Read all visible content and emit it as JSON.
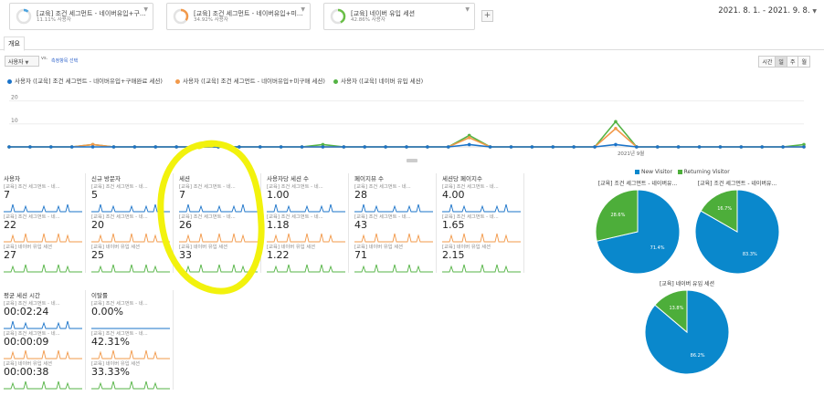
{
  "segments": [
    {
      "name": "[교육] 조건 세그먼트 - 네이버유입+구...",
      "pct": "11.11% 사용자",
      "color": "#4aa3df",
      "fraction": 0.111
    },
    {
      "name": "[교육] 조건 세그먼트 - 네이버유입+미...",
      "pct": "34.92% 사용자",
      "color": "#f2994a",
      "fraction": 0.349
    },
    {
      "name": "[교육] 네이버 유입 세션",
      "pct": "42.86% 사용자",
      "color": "#6abf47",
      "fraction": 0.429
    }
  ],
  "add_segment_label": "+",
  "date_range": "2021. 8. 1. - 2021. 9. 8.",
  "tab_overview": "개요",
  "metric_select": "사용자",
  "vs_label": "vs.",
  "select_metric_label": "측정항목 선택",
  "granularity": [
    "시간",
    "일",
    "주",
    "월"
  ],
  "granularity_active": "일",
  "legend": [
    "사용자 ([교육] 조건 세그먼트 - 네이버유입+구매완료 세션)",
    "사용자 ([교육] 조건 세그먼트 - 네이버유입+미구매 세션)",
    "사용자 ([교육] 네이버 유입 세션)"
  ],
  "colors": {
    "blue": "#1a73c9",
    "orange": "#f2994a",
    "green": "#54b344",
    "pie_blue": "#0a88cc",
    "pie_green": "#4dae3a",
    "highlight": "#f2f20d"
  },
  "chart_data": {
    "type": "line",
    "ylabel_ticks": [
      "20",
      "10"
    ],
    "ylim": [
      0,
      25
    ],
    "x_annotation": "2021년 9월",
    "series": [
      {
        "name": "사용자 ([교육] 조건 세그먼트 - 네이버유입+구매완료 세션)",
        "values": [
          0,
          0,
          0,
          0,
          0,
          0,
          0,
          0,
          0,
          0,
          0,
          0,
          0,
          0,
          0,
          0,
          0,
          0,
          0,
          0,
          0,
          0,
          1,
          0,
          0,
          0,
          0,
          0,
          0,
          1,
          0,
          0,
          0,
          0,
          0,
          0,
          0,
          0,
          0
        ]
      },
      {
        "name": "사용자 ([교육] 조건 세그먼트 - 네이버유입+미구매 세션)",
        "values": [
          0,
          0,
          0,
          0,
          1,
          0,
          0,
          0,
          0,
          0,
          0,
          0,
          0,
          0,
          0,
          0,
          0,
          0,
          0,
          0,
          0,
          0,
          4,
          0,
          0,
          0,
          0,
          0,
          0,
          8,
          0,
          0,
          0,
          0,
          0,
          0,
          0,
          0,
          0
        ]
      },
      {
        "name": "사용자 ([교육] 네이버 유입 세션)",
        "values": [
          0,
          0,
          0,
          0,
          1,
          0,
          0,
          0,
          0,
          0,
          0,
          0,
          0,
          0,
          0,
          1,
          0,
          0,
          0,
          0,
          0,
          0,
          5,
          0,
          0,
          0,
          0,
          0,
          0,
          11,
          0,
          0,
          0,
          0,
          0,
          0,
          0,
          0,
          1
        ]
      }
    ]
  },
  "mini_metrics": [
    {
      "title": "사용자",
      "values": [
        "7",
        "22",
        "27"
      ]
    },
    {
      "title": "신규 방문자",
      "values": [
        "5",
        "20",
        "25"
      ]
    },
    {
      "title": "세션",
      "values": [
        "7",
        "26",
        "33"
      ]
    },
    {
      "title": "사용자당 세션 수",
      "values": [
        "1.00",
        "1.18",
        "1.22"
      ]
    },
    {
      "title": "페이지뷰 수",
      "values": [
        "28",
        "43",
        "71"
      ]
    },
    {
      "title": "세션당 페이지수",
      "values": [
        "4.00",
        "1.65",
        "2.15"
      ]
    },
    {
      "title": "평균 세션 시간",
      "values": [
        "00:02:24",
        "00:00:09",
        "00:00:38"
      ]
    },
    {
      "title": "이탈률",
      "values": [
        "0.00%",
        "42.31%",
        "33.33%"
      ]
    }
  ],
  "mini_seg_labels": [
    "[교육] 조건 세그먼트 - 네...",
    "[교육] 조건 세그먼트 - 네...",
    "[교육] 네이버 유입 세션"
  ],
  "pie_legend": {
    "new": "New Visitor",
    "returning": "Returning Visitor"
  },
  "pies": [
    {
      "title": "[교육] 조건 세그먼트 - 네이버유...",
      "new_pct": 71.4,
      "ret_pct": 28.6,
      "new_label": "71.4%",
      "ret_label": "28.6%"
    },
    {
      "title": "[교육] 조건 세그먼트 - 네이버유...",
      "new_pct": 83.3,
      "ret_pct": 16.7,
      "new_label": "83.3%",
      "ret_label": "16.7%"
    },
    {
      "title": "[교육] 네이버 유입 세션",
      "new_pct": 86.2,
      "ret_pct": 13.8,
      "new_label": "86.2%",
      "ret_label": "13.8%"
    }
  ]
}
